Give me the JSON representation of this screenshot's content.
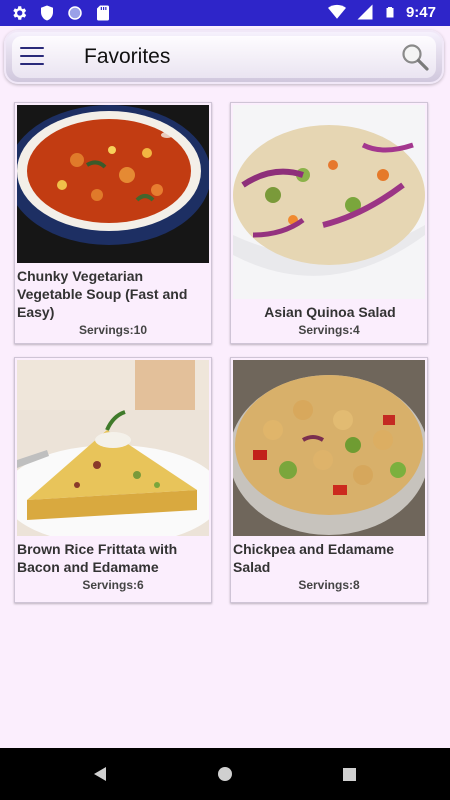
{
  "status_bar": {
    "time": "9:47",
    "left_icons": [
      "settings-icon",
      "shield-icon",
      "circle-icon",
      "sd-card-icon"
    ],
    "right_icons": [
      "wifi-icon",
      "signal-icon",
      "battery-icon"
    ]
  },
  "app_bar": {
    "title": "Favorites",
    "menu_icon": "hamburger-menu-icon",
    "search_icon": "search-icon"
  },
  "recipes": [
    {
      "title": "Chunky Vegetarian Vegetable Soup (Fast and Easy)",
      "servings": "Servings:10",
      "image": "vegetable-soup-photo"
    },
    {
      "title": "Asian Quinoa Salad",
      "servings": "Servings:4",
      "image": "quinoa-salad-photo"
    },
    {
      "title": "Brown Rice Frittata with Bacon and Edamame",
      "servings": "Servings:6",
      "image": "frittata-photo"
    },
    {
      "title": "Chickpea and Edamame Salad",
      "servings": "Servings:8",
      "image": "chickpea-salad-photo"
    }
  ],
  "nav_bar": {
    "icons": [
      "back-icon",
      "home-icon",
      "recent-apps-icon"
    ]
  },
  "colors": {
    "status_bar": "#2e25c9",
    "background": "#fbeefd",
    "nav_bar": "#000000"
  }
}
